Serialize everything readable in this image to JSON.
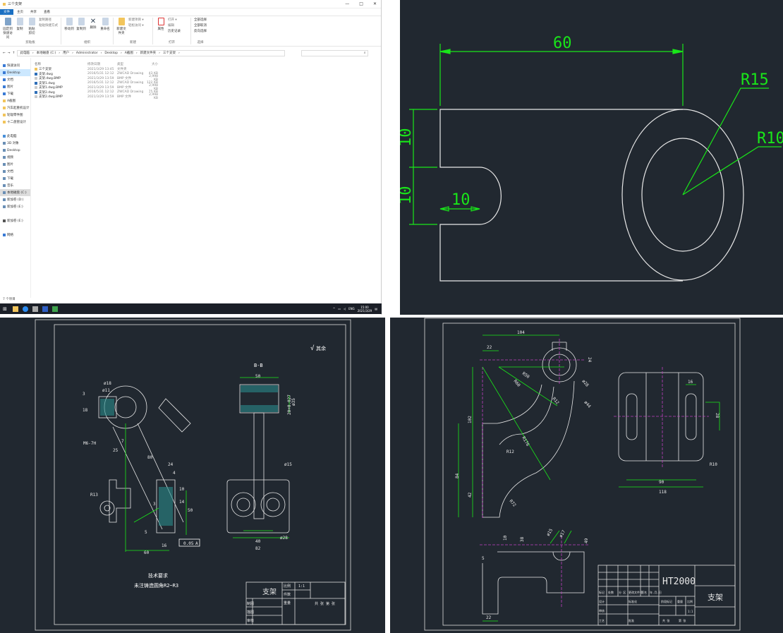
{
  "explorer": {
    "title": "三个支架",
    "window_controls": [
      "—",
      "□",
      "✕"
    ],
    "tabs": [
      "文件",
      "主页",
      "共享",
      "查看"
    ],
    "ribbon": {
      "clipboard": {
        "label": "剪贴板",
        "pin": "固定到快速访问",
        "copy": "复制",
        "paste": "粘贴",
        "cut": "剪切",
        "copy_path": "复制路径",
        "paste_shortcut": "粘贴快捷方式"
      },
      "organize": {
        "label": "组织",
        "move_to": "移动到",
        "copy_to": "复制到",
        "delete": "删除",
        "rename": "重命名"
      },
      "new": {
        "label": "新建",
        "new_folder": "新建文件夹",
        "new_item": "新建项目 ▾",
        "easy_access": "轻松访问 ▾"
      },
      "open": {
        "label": "打开",
        "properties": "属性",
        "open": "打开 ▾",
        "edit": "编辑",
        "history": "历史记录"
      },
      "select": {
        "label": "选择",
        "select_all": "全部选择",
        "select_none": "全部取消",
        "invert": "反向选择"
      }
    },
    "breadcrumb": [
      "此电脑",
      "本地磁盘 (C:)",
      "用户",
      "Administrator",
      "Desktop",
      "A截图",
      "新建文件夹",
      "三个支架"
    ],
    "columns": [
      "名称",
      "修改日期",
      "类型",
      "大小"
    ],
    "files": [
      {
        "name": "三个支架",
        "date": "2021/3/29 13:45",
        "type": "文件夹",
        "size": "",
        "icon": "folder-icon"
      },
      {
        "name": "支架.dwg",
        "date": "2016/5/31 12:12",
        "type": "ZWCAD Drawing",
        "size": "43 KB",
        "icon": "dwg-icon"
      },
      {
        "name": "支架.dwg.BMP",
        "date": "2021/3/29 13:59",
        "type": "BMP 文件",
        "size": "2,998 KB",
        "icon": "bmp-icon"
      },
      {
        "name": "支架1.dwg",
        "date": "2016/5/31 12:12",
        "type": "ZWCAD Drawing",
        "size": "122 KB",
        "icon": "dwg-icon"
      },
      {
        "name": "支架1.dwg.BMP",
        "date": "2021/3/29 13:59",
        "type": "BMP 文件",
        "size": "2,998 KB",
        "icon": "bmp-icon"
      },
      {
        "name": "支架2.dwg",
        "date": "2016/5/31 12:12",
        "type": "ZWCAD Drawing",
        "size": "75 KB",
        "icon": "dwg-icon"
      },
      {
        "name": "支架2.dwg.BMP",
        "date": "2021/3/29 13:59",
        "type": "BMP 文件",
        "size": "2,998 KB",
        "icon": "bmp-icon"
      }
    ],
    "nav": {
      "quick_access": "快速访问",
      "quick_items": [
        "Desktop",
        "文档",
        "图片",
        "下载",
        "A截图",
        "汽车起重机设计",
        "轮辐零件图",
        "十二盘管设计"
      ],
      "this_pc": "此电脑",
      "pc_items": [
        "3D 对象",
        "Desktop",
        "视频",
        "图片",
        "文档",
        "下载",
        "音乐",
        "本地磁盘 (C:)",
        "新加卷 (D:)",
        "新加卷 (E:)"
      ],
      "extra_drive": "新加卷 (E:)",
      "network": "网络"
    },
    "status": "7 个项目",
    "taskbar": {
      "lang": "ENG",
      "time": "15:00",
      "date": "2021/3/29"
    }
  },
  "drawing1": {
    "dims": {
      "width": "60",
      "r_outer": "R15",
      "r_inner": "R10",
      "h_top": "10",
      "h_bottom": "10",
      "slot": "10"
    }
  },
  "drawing2": {
    "section_label": "B-B",
    "roughness_note": "其余",
    "dims": {
      "d18": "ø18",
      "d11": "ø11",
      "h18": "18",
      "d3": "3",
      "m": "M6-7H",
      "d25": "25",
      "d7": "7",
      "d80": "80",
      "d24": "24",
      "d4": "4",
      "d10": "10",
      "d14": "14",
      "d50": "50",
      "d3b": "3",
      "d5": "5",
      "d16": "16",
      "d60": "60",
      "r13": "R13",
      "tol_value": "0.05",
      "tol_datum": "A",
      "w50": "50",
      "h20": "20+0.027",
      "d35": "ø35",
      "d15": "ø15",
      "d28": "ø28",
      "w40": "40",
      "w82": "82"
    },
    "tech_req_title": "技术要求",
    "tech_req_text": "未注铸造圆角R2~R3",
    "title_block": {
      "name": "支架",
      "scale_label": "比例",
      "scale": "1:1",
      "qty_label": "件数",
      "weight_label": "重量",
      "drawn": "制图",
      "design": "描图",
      "review": "审核",
      "material": "共 张 第 张"
    }
  },
  "drawing3": {
    "dims": {
      "d104": "104",
      "d22": "22",
      "d24": "24",
      "r50": "R50",
      "r60": "R60",
      "r12a": "R12",
      "d28": "ø28",
      "d44": "ø44",
      "d102": "102",
      "d84": "84",
      "d42": "42",
      "r12": "R12",
      "r176": "R176",
      "r72": "R72",
      "d16": "16",
      "d28b": "28",
      "r10": "R10",
      "d90": "90",
      "d118": "118",
      "d5": "5",
      "d22b": "22",
      "d10": "10",
      "d38": "38",
      "d49": "49",
      "d15": "ø15",
      "d17": "ø17"
    },
    "title_block": {
      "material": "HT2000",
      "name": "支架",
      "headers": [
        "标记",
        "处数",
        "分 区",
        "更改文件号",
        "签名",
        "年.月.日"
      ],
      "design": "设计",
      "standard": "标准化",
      "stage": "阶段标记",
      "weight": "重量",
      "scale": "比例",
      "scale_val": "1:1",
      "review": "审核",
      "process": "工艺",
      "approve": "批准",
      "sheets": "共 张",
      "sheet": "第 张"
    }
  }
}
